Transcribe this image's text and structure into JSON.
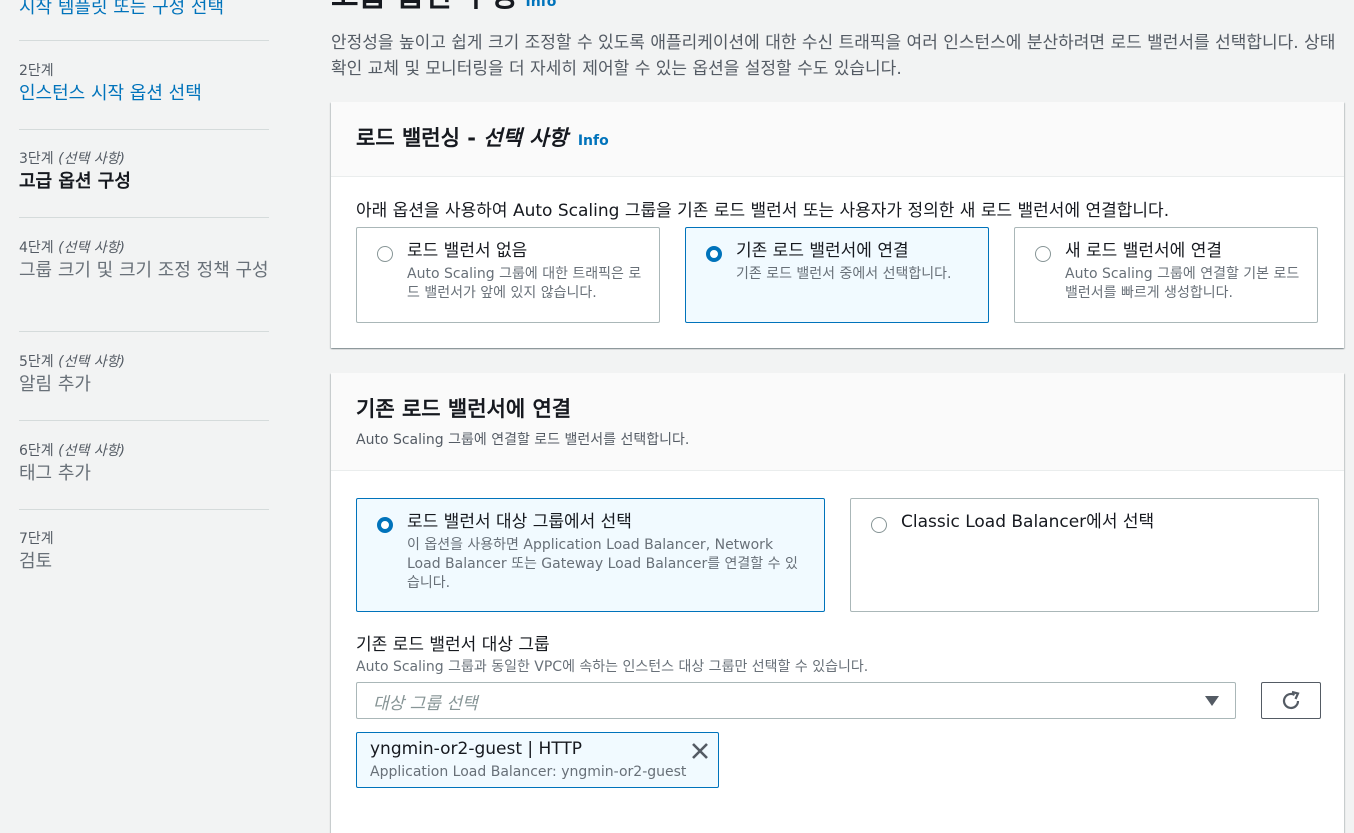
{
  "sidebar": {
    "steps": [
      {
        "title": "시작 템플릿 또는 구성 선택"
      },
      {
        "num": "2단계",
        "opt": "",
        "title": "인스턴스 시작 옵션 선택"
      },
      {
        "num": "3단계",
        "opt": "(선택 사항)",
        "title": "고급 옵션 구성"
      },
      {
        "num": "4단계",
        "opt": "(선택 사항)",
        "title": "그룹 크기 및 크기 조정 정책 구성"
      },
      {
        "num": "5단계",
        "opt": "(선택 사항)",
        "title": "알림 추가"
      },
      {
        "num": "6단계",
        "opt": "(선택 사항)",
        "title": "태그 추가"
      },
      {
        "num": "7단계",
        "opt": "",
        "title": "검토"
      }
    ]
  },
  "page": {
    "title": "고급 옵션 구성",
    "info": "Info",
    "description": "안정성을 높이고 쉽게 크기 조정할 수 있도록 애플리케이션에 대한 수신 트래픽을 여러 인스턴스에 분산하려면 로드 밸런서를 선택합니다. 상태 확인 교체 및 모니터링을 더 자세히 제어할 수 있는 옵션을 설정할 수도 있습니다."
  },
  "lb_panel": {
    "title_prefix": "로드 밸런싱 - ",
    "title_italic": "선택 사항",
    "info": "Info",
    "intro": "아래 옵션을 사용하여 Auto Scaling 그룹을 기존 로드 밸런서 또는 사용자가 정의한 새 로드 밸런서에 연결합니다.",
    "options": [
      {
        "title": "로드 밸런서 없음",
        "desc": "Auto Scaling 그룹에 대한 트래픽은 로드 밸런서가 앞에 있지 않습니다.",
        "selected": false
      },
      {
        "title": "기존 로드 밸런서에 연결",
        "desc": "기존 로드 밸런서 중에서 선택합니다.",
        "selected": true
      },
      {
        "title": "새 로드 밸런서에 연결",
        "desc": "Auto Scaling 그룹에 연결할 기본 로드 밸런서를 빠르게 생성합니다.",
        "selected": false
      }
    ]
  },
  "attach_panel": {
    "title": "기존 로드 밸런서에 연결",
    "subtitle": "Auto Scaling 그룹에 연결할 로드 밸런서를 선택합니다.",
    "options": [
      {
        "title": "로드 밸런서 대상 그룹에서 선택",
        "desc": "이 옵션을 사용하면 Application Load Balancer, Network Load Balancer 또는 Gateway Load Balancer를 연결할 수 있습니다.",
        "selected": true
      },
      {
        "title": "Classic Load Balancer에서 선택",
        "desc": "",
        "selected": false
      }
    ],
    "field_label": "기존 로드 밸런서 대상 그룹",
    "field_desc": "Auto Scaling 그룹과 동일한 VPC에 속하는 인스턴스 대상 그룹만 선택할 수 있습니다.",
    "select_placeholder": "대상 그룹 선택",
    "token": {
      "name": "yngmin-or2-guest | HTTP",
      "detail": "Application Load Balancer: yngmin-or2-guest"
    }
  },
  "colors": {
    "accent": "#0073bb",
    "selected_bg": "#f1faff",
    "sidebar_bg": "#f2f3f3"
  },
  "icons": [
    "refresh-icon",
    "dismiss-icon",
    "caret-down-icon",
    "radio-icon"
  ]
}
